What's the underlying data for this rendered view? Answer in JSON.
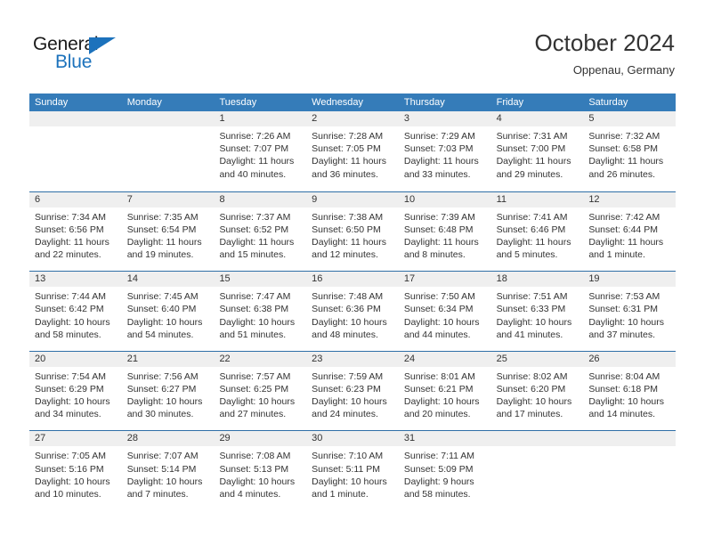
{
  "brand": {
    "name_part1": "General",
    "name_part2": "Blue",
    "accent_color": "#1c72bc"
  },
  "header": {
    "title": "October 2024",
    "location": "Oppenau, Germany"
  },
  "theme": {
    "header_bar_color": "#357cb9",
    "date_band_color": "#efefef",
    "row_separator_color": "#2f6fa7",
    "text_color": "#333333"
  },
  "weekdays": [
    "Sunday",
    "Monday",
    "Tuesday",
    "Wednesday",
    "Thursday",
    "Friday",
    "Saturday"
  ],
  "weeks": [
    [
      {
        "date": "",
        "lines": [
          "",
          "",
          "",
          ""
        ],
        "empty": true
      },
      {
        "date": "",
        "lines": [
          "",
          "",
          "",
          ""
        ],
        "empty": true
      },
      {
        "date": "1",
        "lines": [
          "Sunrise: 7:26 AM",
          "Sunset: 7:07 PM",
          "Daylight: 11 hours",
          "and 40 minutes."
        ]
      },
      {
        "date": "2",
        "lines": [
          "Sunrise: 7:28 AM",
          "Sunset: 7:05 PM",
          "Daylight: 11 hours",
          "and 36 minutes."
        ]
      },
      {
        "date": "3",
        "lines": [
          "Sunrise: 7:29 AM",
          "Sunset: 7:03 PM",
          "Daylight: 11 hours",
          "and 33 minutes."
        ]
      },
      {
        "date": "4",
        "lines": [
          "Sunrise: 7:31 AM",
          "Sunset: 7:00 PM",
          "Daylight: 11 hours",
          "and 29 minutes."
        ]
      },
      {
        "date": "5",
        "lines": [
          "Sunrise: 7:32 AM",
          "Sunset: 6:58 PM",
          "Daylight: 11 hours",
          "and 26 minutes."
        ]
      }
    ],
    [
      {
        "date": "6",
        "lines": [
          "Sunrise: 7:34 AM",
          "Sunset: 6:56 PM",
          "Daylight: 11 hours",
          "and 22 minutes."
        ]
      },
      {
        "date": "7",
        "lines": [
          "Sunrise: 7:35 AM",
          "Sunset: 6:54 PM",
          "Daylight: 11 hours",
          "and 19 minutes."
        ]
      },
      {
        "date": "8",
        "lines": [
          "Sunrise: 7:37 AM",
          "Sunset: 6:52 PM",
          "Daylight: 11 hours",
          "and 15 minutes."
        ]
      },
      {
        "date": "9",
        "lines": [
          "Sunrise: 7:38 AM",
          "Sunset: 6:50 PM",
          "Daylight: 11 hours",
          "and 12 minutes."
        ]
      },
      {
        "date": "10",
        "lines": [
          "Sunrise: 7:39 AM",
          "Sunset: 6:48 PM",
          "Daylight: 11 hours",
          "and 8 minutes."
        ]
      },
      {
        "date": "11",
        "lines": [
          "Sunrise: 7:41 AM",
          "Sunset: 6:46 PM",
          "Daylight: 11 hours",
          "and 5 minutes."
        ]
      },
      {
        "date": "12",
        "lines": [
          "Sunrise: 7:42 AM",
          "Sunset: 6:44 PM",
          "Daylight: 11 hours",
          "and 1 minute."
        ]
      }
    ],
    [
      {
        "date": "13",
        "lines": [
          "Sunrise: 7:44 AM",
          "Sunset: 6:42 PM",
          "Daylight: 10 hours",
          "and 58 minutes."
        ]
      },
      {
        "date": "14",
        "lines": [
          "Sunrise: 7:45 AM",
          "Sunset: 6:40 PM",
          "Daylight: 10 hours",
          "and 54 minutes."
        ]
      },
      {
        "date": "15",
        "lines": [
          "Sunrise: 7:47 AM",
          "Sunset: 6:38 PM",
          "Daylight: 10 hours",
          "and 51 minutes."
        ]
      },
      {
        "date": "16",
        "lines": [
          "Sunrise: 7:48 AM",
          "Sunset: 6:36 PM",
          "Daylight: 10 hours",
          "and 48 minutes."
        ]
      },
      {
        "date": "17",
        "lines": [
          "Sunrise: 7:50 AM",
          "Sunset: 6:34 PM",
          "Daylight: 10 hours",
          "and 44 minutes."
        ]
      },
      {
        "date": "18",
        "lines": [
          "Sunrise: 7:51 AM",
          "Sunset: 6:33 PM",
          "Daylight: 10 hours",
          "and 41 minutes."
        ]
      },
      {
        "date": "19",
        "lines": [
          "Sunrise: 7:53 AM",
          "Sunset: 6:31 PM",
          "Daylight: 10 hours",
          "and 37 minutes."
        ]
      }
    ],
    [
      {
        "date": "20",
        "lines": [
          "Sunrise: 7:54 AM",
          "Sunset: 6:29 PM",
          "Daylight: 10 hours",
          "and 34 minutes."
        ]
      },
      {
        "date": "21",
        "lines": [
          "Sunrise: 7:56 AM",
          "Sunset: 6:27 PM",
          "Daylight: 10 hours",
          "and 30 minutes."
        ]
      },
      {
        "date": "22",
        "lines": [
          "Sunrise: 7:57 AM",
          "Sunset: 6:25 PM",
          "Daylight: 10 hours",
          "and 27 minutes."
        ]
      },
      {
        "date": "23",
        "lines": [
          "Sunrise: 7:59 AM",
          "Sunset: 6:23 PM",
          "Daylight: 10 hours",
          "and 24 minutes."
        ]
      },
      {
        "date": "24",
        "lines": [
          "Sunrise: 8:01 AM",
          "Sunset: 6:21 PM",
          "Daylight: 10 hours",
          "and 20 minutes."
        ]
      },
      {
        "date": "25",
        "lines": [
          "Sunrise: 8:02 AM",
          "Sunset: 6:20 PM",
          "Daylight: 10 hours",
          "and 17 minutes."
        ]
      },
      {
        "date": "26",
        "lines": [
          "Sunrise: 8:04 AM",
          "Sunset: 6:18 PM",
          "Daylight: 10 hours",
          "and 14 minutes."
        ]
      }
    ],
    [
      {
        "date": "27",
        "lines": [
          "Sunrise: 7:05 AM",
          "Sunset: 5:16 PM",
          "Daylight: 10 hours",
          "and 10 minutes."
        ]
      },
      {
        "date": "28",
        "lines": [
          "Sunrise: 7:07 AM",
          "Sunset: 5:14 PM",
          "Daylight: 10 hours",
          "and 7 minutes."
        ]
      },
      {
        "date": "29",
        "lines": [
          "Sunrise: 7:08 AM",
          "Sunset: 5:13 PM",
          "Daylight: 10 hours",
          "and 4 minutes."
        ]
      },
      {
        "date": "30",
        "lines": [
          "Sunrise: 7:10 AM",
          "Sunset: 5:11 PM",
          "Daylight: 10 hours",
          "and 1 minute."
        ]
      },
      {
        "date": "31",
        "lines": [
          "Sunrise: 7:11 AM",
          "Sunset: 5:09 PM",
          "Daylight: 9 hours",
          "and 58 minutes."
        ]
      },
      {
        "date": "",
        "lines": [
          "",
          "",
          "",
          ""
        ],
        "empty": true
      },
      {
        "date": "",
        "lines": [
          "",
          "",
          "",
          ""
        ],
        "empty": true
      }
    ]
  ]
}
